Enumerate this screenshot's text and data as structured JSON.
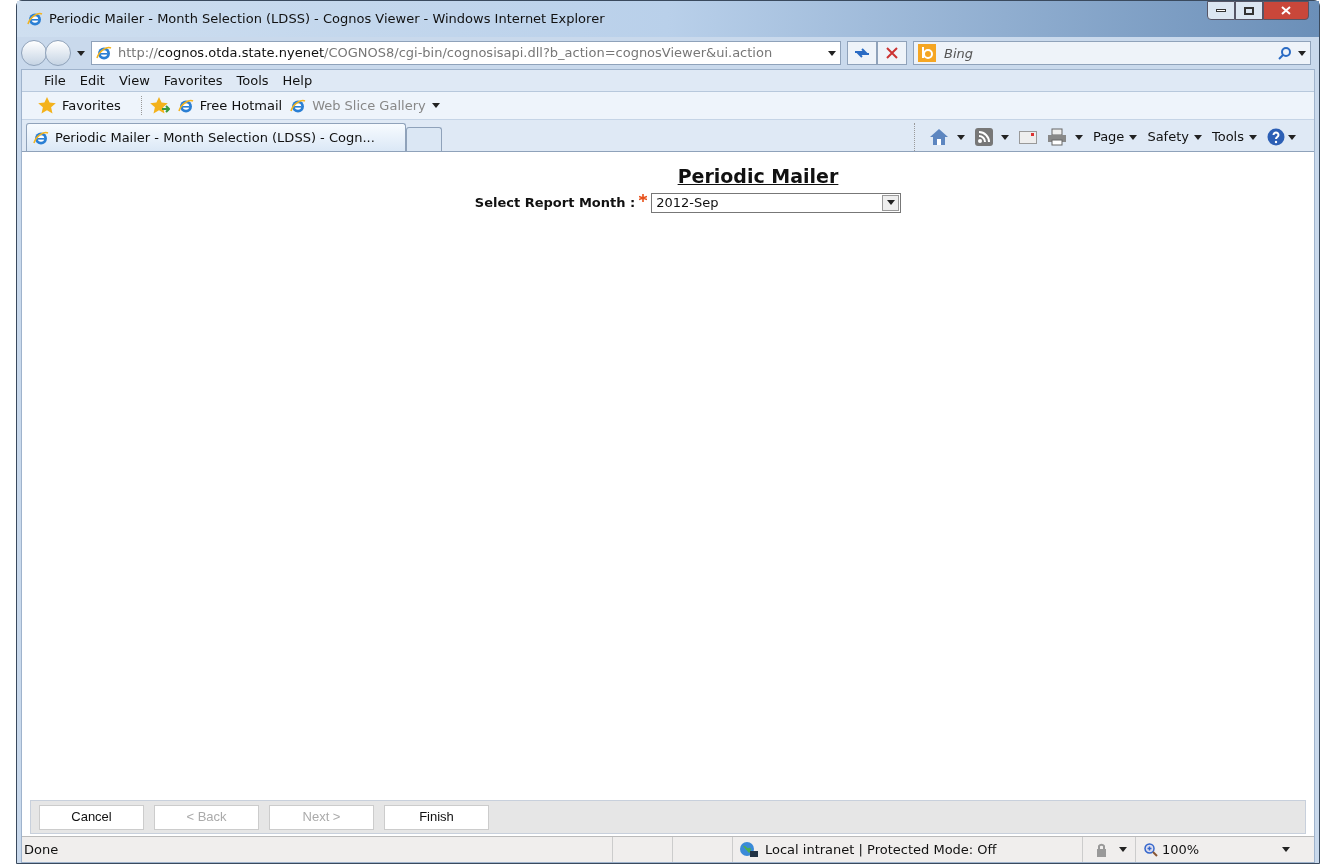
{
  "window": {
    "title": "Periodic Mailer - Month Selection (LDSS) - Cognos Viewer - Windows Internet Explorer"
  },
  "address": {
    "url": "http://**cognos.otda.state.nyenet**/COGNOS8/cgi-bin/cognosisapi.dll?b_action=cognosViewer&ui.action"
  },
  "search": {
    "placeholder": "Bing"
  },
  "menu": [
    "File",
    "Edit",
    "View",
    "Favorites",
    "Tools",
    "Help"
  ],
  "favorites_bar": {
    "label": "Favorites",
    "links": [
      {
        "label": "Free Hotmail",
        "disabled": false
      },
      {
        "label": "Web Slice Gallery",
        "disabled": true
      }
    ]
  },
  "tabs": [
    {
      "label": "Periodic Mailer - Month Selection (LDSS) - Cogn...",
      "selected": true
    }
  ],
  "command_bar": [
    "Page",
    "Safety",
    "Tools"
  ],
  "report": {
    "title": "Periodic Mailer",
    "prompt": {
      "label": "Select Report Month :",
      "required": true,
      "value": "2012-Sep"
    }
  },
  "buttons": [
    {
      "label": "Cancel",
      "disabled": false
    },
    {
      "label": "< Back",
      "disabled": true
    },
    {
      "label": "Next >",
      "disabled": true
    },
    {
      "label": "Finish",
      "disabled": false
    }
  ],
  "status_bar": {
    "text": "Done",
    "zone": "Local intranet | Protected Mode: Off",
    "zoom": "100%"
  }
}
